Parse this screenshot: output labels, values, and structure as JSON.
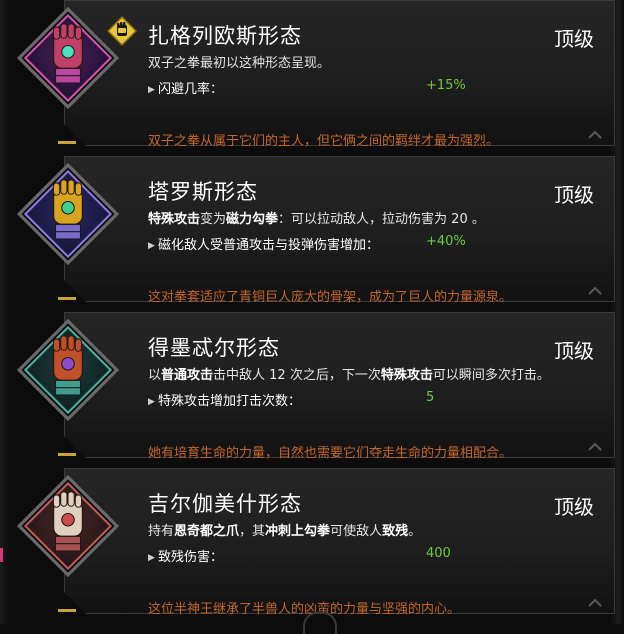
{
  "aspects": [
    {
      "name": "扎格列欧斯形态",
      "level": "顶级",
      "desc_segments": [
        {
          "text": "双子之拳最初以这种形态呈现。",
          "hl": false
        }
      ],
      "stat_label": "闪避几率：",
      "stat_value": "+15%",
      "flavor": "双子之拳从属于它们的主人，但它俩之间的羁绊才最为强烈。",
      "equipped": true,
      "icon": "gauntlet-zagreus-icon",
      "colors": {
        "frame": "#d44fb0",
        "bg1": "#4a1f5c",
        "bg2": "#1a0f2a",
        "glove": "#c0406a",
        "gem": "#4fe0c0"
      }
    },
    {
      "name": "塔罗斯形态",
      "level": "顶级",
      "desc_segments": [
        {
          "text": "特殊攻击",
          "hl": true
        },
        {
          "text": "变为",
          "hl": false
        },
        {
          "text": "磁力勾拳",
          "hl": true
        },
        {
          "text": "：可以拉动敌人，拉动伤害为 20 。",
          "hl": false
        }
      ],
      "stat_label": "磁化敌人受普通攻击与投弹伤害增加：",
      "stat_value": "+40%",
      "flavor": "这对拳套适应了青铜巨人庞大的骨架，成为了巨人的力量源泉。",
      "equipped": false,
      "icon": "gauntlet-talos-icon",
      "colors": {
        "frame": "#8a78e0",
        "bg1": "#2a2a6a",
        "bg2": "#12122e",
        "glove": "#d8a422",
        "gem": "#3ad08a"
      }
    },
    {
      "name": "得墨忒尔形态",
      "level": "顶级",
      "desc_segments": [
        {
          "text": "以",
          "hl": false
        },
        {
          "text": "普通攻击",
          "hl": true
        },
        {
          "text": "击中敌人 12 次之后，下一次",
          "hl": false
        },
        {
          "text": "特殊攻击",
          "hl": true
        },
        {
          "text": "可以瞬间多次打击。",
          "hl": false
        }
      ],
      "stat_label": "特殊攻击增加打击次数：",
      "stat_value": "5",
      "flavor": "她有培育生命的力量，自然也需要它们夺走生命的力量相配合。",
      "equipped": false,
      "icon": "gauntlet-demeter-icon",
      "colors": {
        "frame": "#4ab0a0",
        "bg1": "#1e3c3c",
        "bg2": "#0e1c1e",
        "glove": "#c0502a",
        "gem": "#8a4fd0"
      }
    },
    {
      "name": "吉尔伽美什形态",
      "level": "顶级",
      "desc_segments": [
        {
          "text": "持有",
          "hl": false
        },
        {
          "text": "恩奇都之爪",
          "hl": true
        },
        {
          "text": "，其",
          "hl": false
        },
        {
          "text": "冲刺上勾拳",
          "hl": true
        },
        {
          "text": "可使敌人",
          "hl": false
        },
        {
          "text": "致残",
          "hl": true
        },
        {
          "text": "。",
          "hl": false
        }
      ],
      "stat_label": "致残伤害：",
      "stat_value": "400",
      "flavor": "这位半神王继承了半兽人的凶蛮的力量与坚强的内心。",
      "equipped": false,
      "icon": "gauntlet-gilgamesh-icon",
      "colors": {
        "frame": "#c05a5a",
        "bg1": "#4a2a2a",
        "bg2": "#1e1010",
        "glove": "#e0d0c0",
        "gem": "#d04a4a"
      }
    }
  ]
}
